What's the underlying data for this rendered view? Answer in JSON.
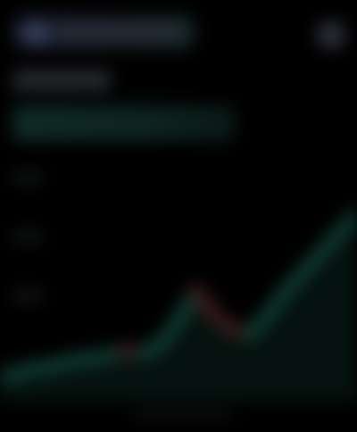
{
  "header": {
    "pair_label": "",
    "pair_icon": "coin-pair-icon",
    "menu_icon": "menu-icon"
  },
  "price": {
    "value": "",
    "change": ""
  },
  "chart": {
    "y_ticks": [
      "",
      "",
      ""
    ],
    "x_label": ""
  },
  "colors": {
    "background": "#000000",
    "up": "#0f3a30",
    "down": "#3a1a1c",
    "pill_left": "#1a2032",
    "pill_right": "#10231f"
  },
  "chart_data": {
    "type": "line",
    "x": [
      0,
      1,
      2,
      3,
      4,
      5,
      6,
      7,
      8,
      9,
      10,
      11,
      12,
      13,
      14,
      15,
      16,
      17,
      18,
      19,
      20
    ],
    "series": [
      {
        "values": [
          10,
          12,
          14,
          15,
          17,
          18,
          19,
          21,
          20,
          24,
          34,
          46,
          36,
          30,
          28,
          36,
          46,
          54,
          62,
          70,
          78
        ]
      }
    ],
    "ylim": [
      0,
      100
    ],
    "grid": false
  }
}
